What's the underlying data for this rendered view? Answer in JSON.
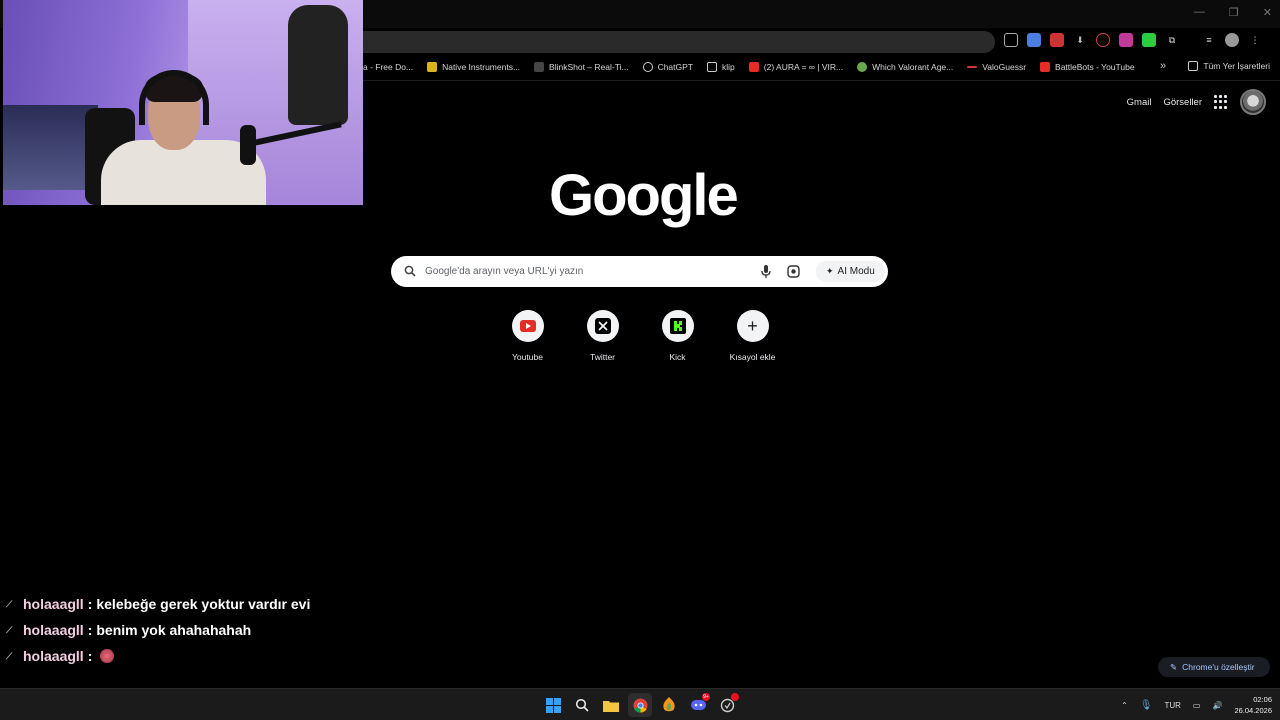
{
  "browser": {
    "bookmarks": [
      {
        "label": "a - Free Do...",
        "color": "#333"
      },
      {
        "label": "Native Instruments...",
        "color": "#d9b21c"
      },
      {
        "label": "BlinkShot – Real-Ti...",
        "color": "#444",
        "badge": "BS"
      },
      {
        "label": "ChatGPT",
        "color": "#555"
      },
      {
        "label": "klip",
        "folder": true
      },
      {
        "label": "(2) AURA = ∞ | VIR...",
        "color": "#e52d27"
      },
      {
        "label": "Which Valorant Age...",
        "color": "#6aa84f"
      },
      {
        "label": "ValoGuessr",
        "color": "#d63333"
      },
      {
        "label": "BattleBots - YouTube",
        "color": "#e52d27"
      }
    ],
    "more_bookmarks": "»",
    "all_bookmarks": "Tüm Yer İşaretleri"
  },
  "google": {
    "logo": "Google",
    "gmail": "Gmail",
    "images": "Görseller",
    "search_placeholder": "Google'da arayın veya URL'yi yazın",
    "ai_mode": "AI Modu",
    "shortcuts": [
      {
        "label": "Youtube",
        "icon": "youtube-icon"
      },
      {
        "label": "Twitter",
        "icon": "x-icon"
      },
      {
        "label": "Kick",
        "icon": "kick-icon"
      },
      {
        "label": "Kısayol ekle",
        "icon": "plus-icon"
      }
    ],
    "customize": "Chrome'u özelleştir"
  },
  "chat": [
    {
      "user": "holaaagll",
      "message": "kelebeğe gerek yoktur vardır evi"
    },
    {
      "user": "holaaagll",
      "message": "benim yok ahahahahah"
    },
    {
      "user": "holaaagll",
      "message": ""
    }
  ],
  "taskbar": {
    "language": "TUR",
    "time": "02:06",
    "date": "26.04.2026",
    "discord_badge": "9+"
  }
}
